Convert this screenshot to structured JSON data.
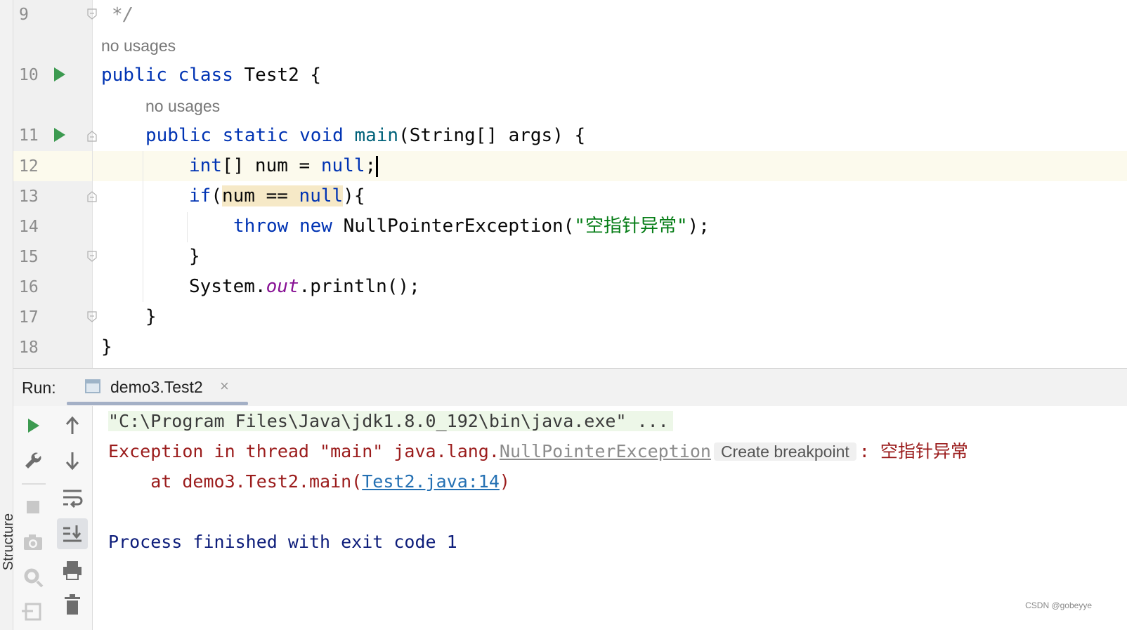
{
  "side_tab": "Structure",
  "editor": {
    "lines": [
      {
        "no": "9",
        "comment": "*/"
      },
      {
        "hint": "no usages"
      },
      {
        "no": "10",
        "parts": [
          "public",
          "class",
          "Test2 {"
        ]
      },
      {
        "hint": "no usages"
      },
      {
        "no": "11",
        "parts": [
          "public",
          "static",
          "void",
          "main",
          "(String[] args) {"
        ]
      },
      {
        "no": "12",
        "parts": [
          "int",
          "[] num = ",
          "null",
          ";"
        ]
      },
      {
        "no": "13",
        "parts": [
          "if",
          "(",
          "num == ",
          "null",
          "){"
        ]
      },
      {
        "no": "14",
        "parts": [
          "throw",
          "new",
          "NullPointerException(",
          "\"空指针异常\"",
          ");"
        ]
      },
      {
        "no": "15",
        "parts": [
          "}"
        ]
      },
      {
        "no": "16",
        "parts": [
          "System.",
          "out",
          ".println();"
        ]
      },
      {
        "no": "17",
        "parts": [
          "}"
        ]
      },
      {
        "no": "18",
        "parts": [
          "}"
        ]
      }
    ]
  },
  "run_panel": {
    "label": "Run:",
    "tab_title": "demo3.Test2",
    "tab_close": "×",
    "console": {
      "cmd": "\"C:\\Program Files\\Java\\jdk1.8.0_192\\bin\\java.exe\" ...",
      "exception_prefix": "Exception in thread \"main\" java.lang.",
      "exception_class": "NullPointerException",
      "breakpoint_chip": "Create breakpoint",
      "exception_suffix": ": 空指针异常",
      "at_prefix": "    at demo3.Test2.main(",
      "at_link": "Test2.java:14",
      "at_suffix": ")",
      "finished": "Process finished with exit code 1"
    }
  },
  "watermark": "CSDN @gobeyye"
}
